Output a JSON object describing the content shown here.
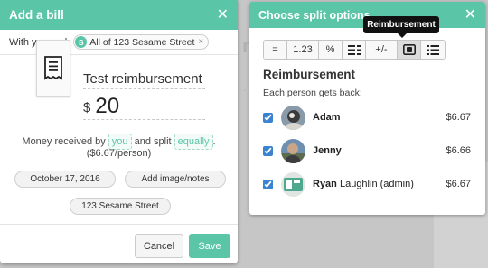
{
  "background": {
    "ghost_title": "ny",
    "ghost_text": "…"
  },
  "bill_dialog": {
    "title": "Add a bill",
    "with_label": "With you and:",
    "group_chip": {
      "badge": "S",
      "label": "All of 123 Sesame Street",
      "remove": "×"
    },
    "description": "Test reimbursement",
    "currency": "$",
    "amount": "20",
    "sentence": {
      "prefix": "Money received by",
      "payer": "you",
      "middle": "and split",
      "method": "equally",
      "suffix": ".",
      "per_person": "($6.67/person)"
    },
    "date_button": "October 17, 2016",
    "image_button": "Add image/notes",
    "group_button": "123 Sesame Street",
    "cancel": "Cancel",
    "save": "Save"
  },
  "split_dialog": {
    "title": "Choose split options",
    "tooltip": "Reimbursement",
    "tabs": [
      {
        "name": "equal",
        "label": "="
      },
      {
        "name": "exact",
        "label": "1.23"
      },
      {
        "name": "percent",
        "label": "%"
      },
      {
        "name": "shares",
        "label": ""
      },
      {
        "name": "adjustment",
        "label": "+/-"
      },
      {
        "name": "reimbursement",
        "label": ""
      },
      {
        "name": "itemized",
        "label": ""
      }
    ],
    "active_tab": "reimbursement",
    "heading": "Reimbursement",
    "subheading": "Each person gets back:",
    "people": [
      {
        "name": "Adam",
        "suffix": "",
        "amount": "$6.67",
        "checked": true
      },
      {
        "name": "Jenny",
        "suffix": "",
        "amount": "$6.66",
        "checked": true
      },
      {
        "name": "Ryan",
        "suffix": " Laughlin (admin)",
        "amount": "$6.67",
        "checked": true
      }
    ]
  },
  "colors": {
    "brand_green": "#5bc5a7",
    "checkbox_blue": "#3b83d1",
    "tooltip_bg": "#111111"
  }
}
